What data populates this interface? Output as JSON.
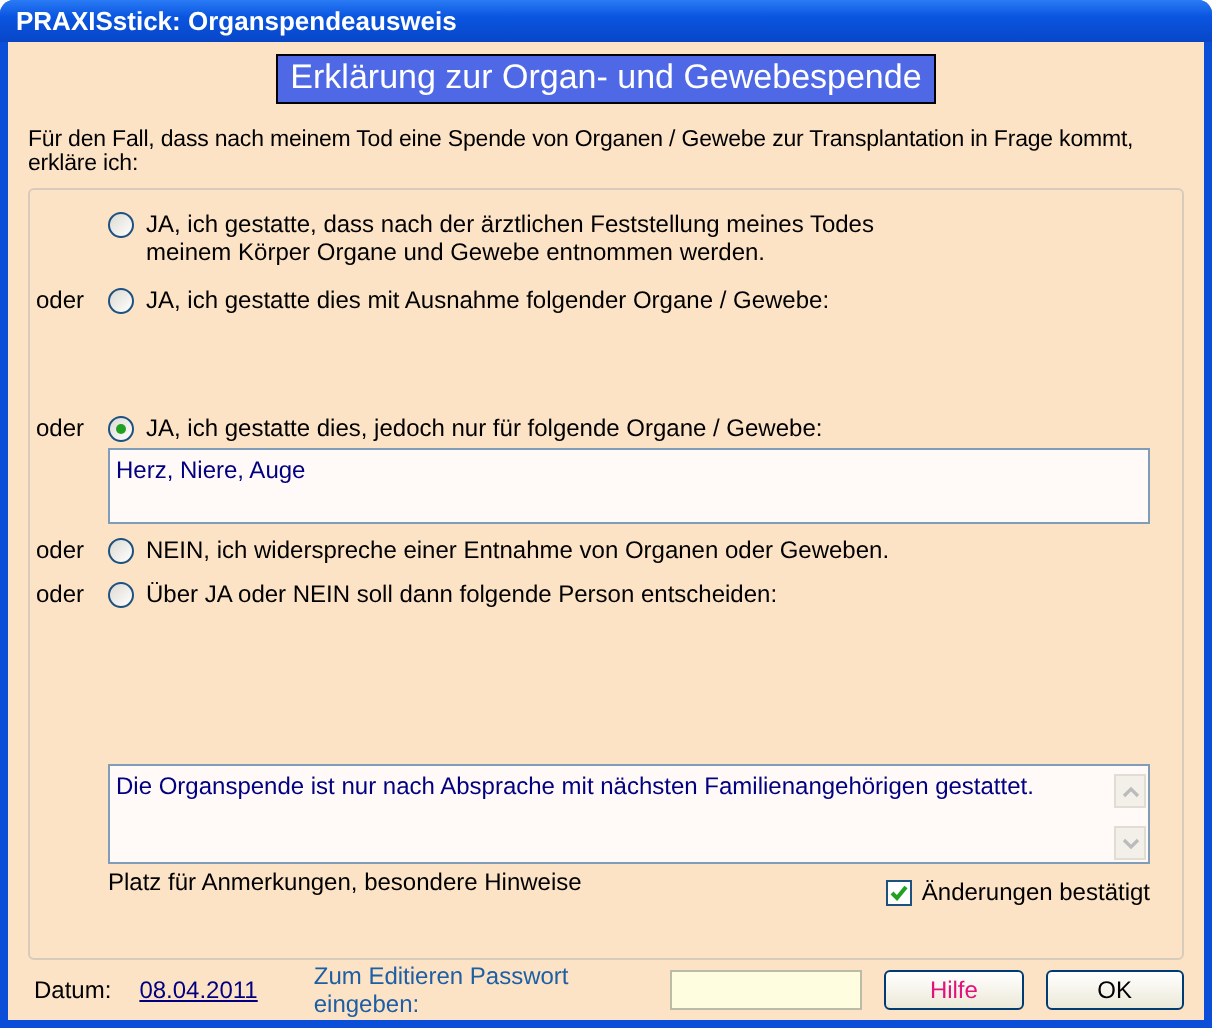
{
  "window": {
    "title": "PRAXISstick: Organspendeausweis"
  },
  "heading": "Erklärung zur Organ- und Gewebespende",
  "intro": "Für den Fall, dass nach meinem Tod eine Spende von Organen / Gewebe zur Transplantation in Frage kommt, erkläre ich:",
  "options": [
    {
      "label": "JA, ich gestatte, dass nach der ärztlichen Feststellung meines Todes\nmeinem Körper Organe und Gewebe entnommen werden.",
      "selected": false
    },
    {
      "prefix": "oder",
      "label": "JA, ich gestatte dies mit Ausnahme folgender Organe / Gewebe:",
      "selected": false
    },
    {
      "prefix": "oder",
      "label": "JA, ich gestatte dies, jedoch nur für folgende Organe / Gewebe:",
      "selected": true,
      "field": "Herz, Niere, Auge"
    },
    {
      "prefix": "oder",
      "label": "NEIN, ich widerspreche einer Entnahme von Organen oder Geweben.",
      "selected": false
    },
    {
      "prefix": "oder",
      "label": "Über JA oder NEIN soll dann folgende Person entscheiden:",
      "selected": false
    }
  ],
  "remarks": {
    "value": "Die Organspende ist nur nach Absprache mit nächsten Familienangehörigen gestattet.",
    "caption": "Platz für Anmerkungen, besondere Hinweise"
  },
  "confirm": {
    "label": "Änderungen bestätigt",
    "checked": true
  },
  "footer": {
    "date_label": "Datum:",
    "date": "08.04.2011",
    "password_label": "Zum Editieren Passwort eingeben:"
  },
  "buttons": [
    "Hilfe",
    "OK"
  ]
}
